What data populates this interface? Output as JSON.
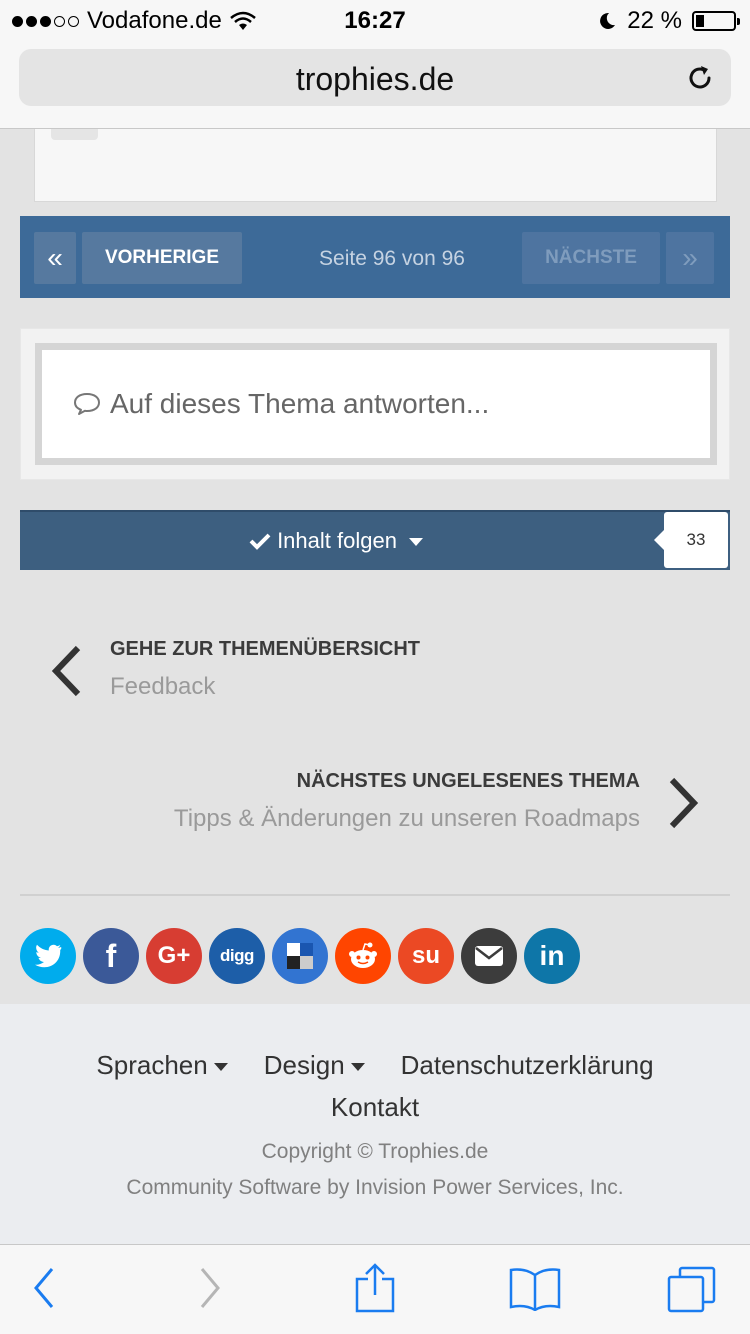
{
  "status_bar": {
    "carrier": "Vodafone.de",
    "time": "16:27",
    "battery": "22 %",
    "battery_level": 0.22
  },
  "browser": {
    "url": "trophies.de"
  },
  "pagination": {
    "first_icon": "«",
    "previous": "VORHERIGE",
    "page_info": "Seite 96 von 96",
    "next": "NÄCHSTE",
    "last_icon": "»"
  },
  "reply": {
    "placeholder": "Auf dieses Thema antworten..."
  },
  "follow": {
    "label": "Inhalt folgen",
    "count": "33"
  },
  "nav_back": {
    "heading": "GEHE ZUR THEMENÜBERSICHT",
    "title": "Feedback"
  },
  "nav_next": {
    "heading": "NÄCHSTES UNGELESENES THEMA",
    "title": "Tipps & Änderungen zu unseren Roadmaps"
  },
  "share": [
    {
      "name": "twitter-icon",
      "color": "#00aced",
      "glyph": "t"
    },
    {
      "name": "facebook-icon",
      "color": "#3b5998",
      "glyph": "f"
    },
    {
      "name": "google-plus-icon",
      "color": "#d73d32",
      "glyph": "G+"
    },
    {
      "name": "digg-icon",
      "color": "#1d5ea8",
      "glyph": "digg"
    },
    {
      "name": "delicious-icon",
      "color": "#3274d1",
      "glyph": ""
    },
    {
      "name": "reddit-icon",
      "color": "#ff4500",
      "glyph": ""
    },
    {
      "name": "stumbleupon-icon",
      "color": "#eb4924",
      "glyph": "su"
    },
    {
      "name": "email-icon",
      "color": "#3c3c3c",
      "glyph": ""
    },
    {
      "name": "linkedin-icon",
      "color": "#0e76a8",
      "glyph": "in"
    }
  ],
  "footer": {
    "languages": "Sprachen",
    "design": "Design",
    "privacy": "Datenschutzerklärung",
    "contact": "Kontakt",
    "copyright": "Copyright © Trophies.de",
    "powered_by": "Community Software by Invision Power Services, Inc."
  }
}
